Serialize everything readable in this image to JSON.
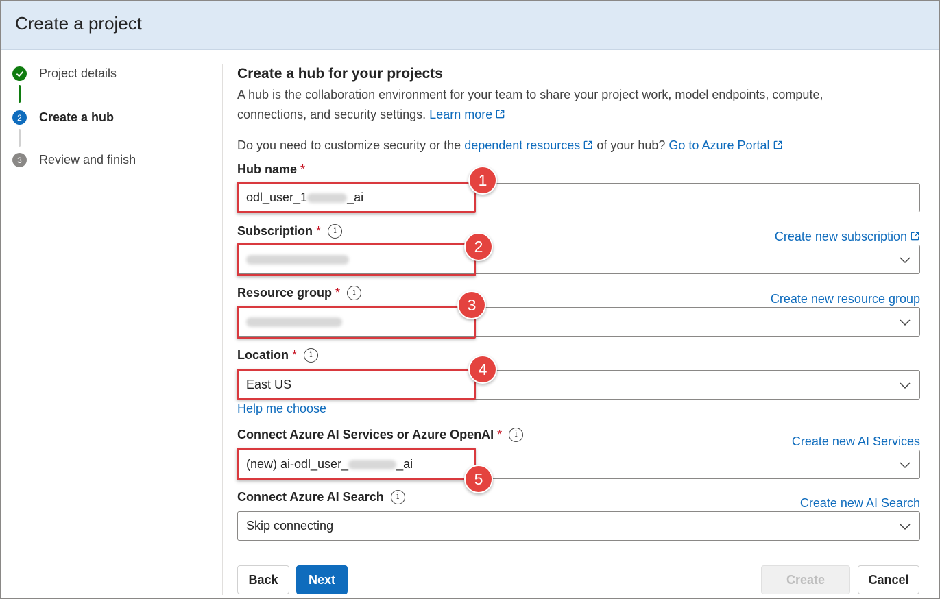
{
  "window": {
    "title": "Create a project"
  },
  "steps": [
    {
      "number": "1",
      "label": "Project details",
      "status": "complete"
    },
    {
      "number": "2",
      "label": "Create a hub",
      "status": "current"
    },
    {
      "number": "3",
      "label": "Review and finish",
      "status": "pending"
    }
  ],
  "main": {
    "heading": "Create a hub for your projects",
    "description": "A hub is the collaboration environment for your team to share your project work, model endpoints, compute, connections, and security settings.",
    "learn_more": "Learn more",
    "question_prefix": "Do you need to customize security or the",
    "dependent_resources_link": "dependent resources",
    "question_suffix": "of your hub?",
    "azure_portal_link": "Go to Azure Portal"
  },
  "fields": {
    "hub_name": {
      "label": "Hub name",
      "required": "*",
      "value_prefix": "odl_user_1",
      "value_suffix": "_ai"
    },
    "subscription": {
      "label": "Subscription",
      "required": "*",
      "link": "Create new subscription"
    },
    "resource_group": {
      "label": "Resource group",
      "required": "*",
      "link": "Create new resource group"
    },
    "location": {
      "label": "Location",
      "required": "*",
      "value": "East US",
      "help_link": "Help me choose"
    },
    "ai_services": {
      "label": "Connect Azure AI Services or Azure OpenAI",
      "required": "*",
      "value_prefix": "(new) ai-odl_user_",
      "value_suffix": "_ai",
      "link": "Create new AI Services"
    },
    "ai_search": {
      "label": "Connect Azure AI Search",
      "value": "Skip connecting",
      "link": "Create new AI Search"
    }
  },
  "info_glyph": "i",
  "badges": [
    "1",
    "2",
    "3",
    "4",
    "5"
  ],
  "buttons": {
    "back": "Back",
    "next": "Next",
    "create": "Create",
    "cancel": "Cancel"
  },
  "colors": {
    "accent": "#0f6cbd",
    "complete": "#107c10",
    "highlight": "#d9393e",
    "required": "#c50f1f",
    "header_bg": "#dde9f5"
  },
  "icons": {
    "check": "check-icon",
    "external": "external-link-icon",
    "chevron": "chevron-down-icon",
    "info": "info-icon"
  }
}
